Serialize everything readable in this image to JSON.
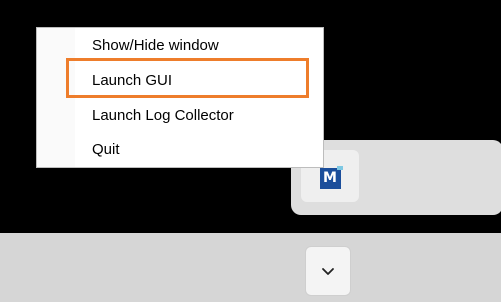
{
  "context_menu": {
    "items": [
      {
        "label": "Show/Hide window"
      },
      {
        "label": "Launch GUI"
      },
      {
        "label": "Launch Log Collector"
      },
      {
        "label": "Quit"
      }
    ],
    "highlighted_item": "Launch GUI",
    "highlight_color": "#ee7d2b"
  },
  "tray": {
    "app_icon": {
      "name": "app-tray-icon",
      "glyph": "M",
      "color": "#1b4e9b"
    },
    "chevron": {
      "name": "chevron-down-icon"
    }
  }
}
